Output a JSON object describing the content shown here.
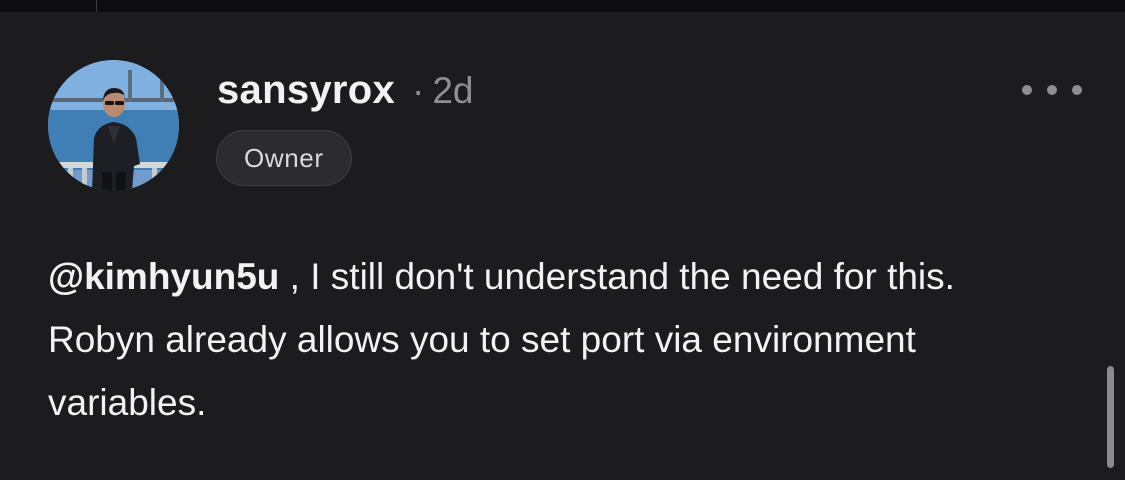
{
  "comment": {
    "author": "sansyrox",
    "separator": "·",
    "age": "2d",
    "role_badge": "Owner",
    "mention": "@kimhyun5u",
    "text_after_mention": " , I still don't understand the need for this. Robyn already allows you to set port via environment variables."
  },
  "icons": {
    "more": "more-horizontal-icon"
  },
  "colors": {
    "background": "#1c1c1f",
    "text": "#f2f2f4",
    "muted": "#8e8e93",
    "badge_bg": "#2c2c30"
  }
}
